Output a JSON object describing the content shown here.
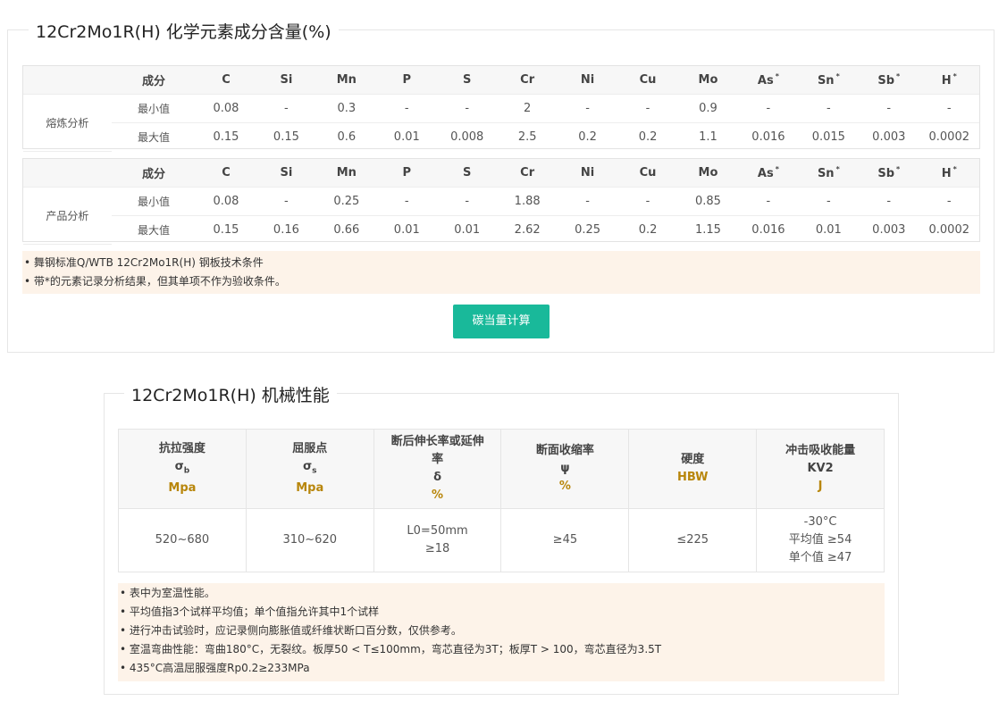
{
  "composition": {
    "title": "12Cr2Mo1R(H) 化学元素成分含量(%)",
    "header_label": "成分",
    "elements": [
      {
        "sym": "C",
        "star": false
      },
      {
        "sym": "Si",
        "star": false
      },
      {
        "sym": "Mn",
        "star": false
      },
      {
        "sym": "P",
        "star": false
      },
      {
        "sym": "S",
        "star": false
      },
      {
        "sym": "Cr",
        "star": false
      },
      {
        "sym": "Ni",
        "star": false
      },
      {
        "sym": "Cu",
        "star": false
      },
      {
        "sym": "Mo",
        "star": false
      },
      {
        "sym": "As",
        "star": true
      },
      {
        "sym": "Sn",
        "star": true
      },
      {
        "sym": "Sb",
        "star": true
      },
      {
        "sym": "H",
        "star": true
      }
    ],
    "star": "*",
    "tables": [
      {
        "label": "熔炼分析",
        "rows": [
          {
            "label": "最小值",
            "values": [
              "0.08",
              "-",
              "0.3",
              "-",
              "-",
              "2",
              "-",
              "-",
              "0.9",
              "-",
              "-",
              "-",
              "-"
            ]
          },
          {
            "label": "最大值",
            "values": [
              "0.15",
              "0.15",
              "0.6",
              "0.01",
              "0.008",
              "2.5",
              "0.2",
              "0.2",
              "1.1",
              "0.016",
              "0.015",
              "0.003",
              "0.0002"
            ]
          }
        ]
      },
      {
        "label": "产品分析",
        "rows": [
          {
            "label": "最小值",
            "values": [
              "0.08",
              "-",
              "0.25",
              "-",
              "-",
              "1.88",
              "-",
              "-",
              "0.85",
              "-",
              "-",
              "-",
              "-"
            ]
          },
          {
            "label": "最大值",
            "values": [
              "0.15",
              "0.16",
              "0.66",
              "0.01",
              "0.01",
              "2.62",
              "0.25",
              "0.2",
              "1.15",
              "0.016",
              "0.01",
              "0.003",
              "0.0002"
            ]
          }
        ]
      }
    ],
    "notes": [
      "• 舞钢标准Q/WTB 12Cr2Mo1R(H) 钢板技术条件",
      "• 带*的元素记录分析结果，但其单项不作为验收条件。"
    ],
    "button_label": "碳当量计算"
  },
  "mechanical": {
    "title": "12Cr2Mo1R(H) 机械性能",
    "columns": [
      {
        "name_lines": [
          "抗拉强度"
        ],
        "symbol": "σ",
        "symbol_sub": "b",
        "unit": "Mpa",
        "value_lines": [
          "520~680"
        ]
      },
      {
        "name_lines": [
          "屈服点"
        ],
        "symbol": "σ",
        "symbol_sub": "s",
        "unit": "Mpa",
        "value_lines": [
          "310~620"
        ]
      },
      {
        "name_lines": [
          "断后伸长率或延伸",
          "率"
        ],
        "symbol": "δ",
        "symbol_sub": "",
        "unit": "%",
        "value_lines": [
          "L0=50mm",
          "≥18"
        ]
      },
      {
        "name_lines": [
          "断面收缩率"
        ],
        "symbol": "ψ",
        "symbol_sub": "",
        "unit": "%",
        "value_lines": [
          "≥45"
        ]
      },
      {
        "name_lines": [
          "硬度"
        ],
        "symbol": "",
        "symbol_sub": "",
        "unit": "HBW",
        "value_lines": [
          "≤225"
        ]
      },
      {
        "name_lines": [
          "冲击吸收能量"
        ],
        "symbol": "KV2",
        "symbol_sub": "",
        "unit": "J",
        "value_lines": [
          "-30°C",
          "平均值 ≥54",
          "单个值 ≥47"
        ]
      }
    ],
    "notes": [
      "• 表中为室温性能。",
      "• 平均值指3个试样平均值；单个值指允许其中1个试样",
      "• 进行冲击试验时，应记录侧向膨胀值或纤维状断口百分数，仅供参考。",
      "• 室温弯曲性能：弯曲180°C，无裂纹。板厚50 < T≤100mm，弯芯直径为3T；板厚T > 100，弯芯直径为3.5T",
      "• 435°C高温屈服强度Rp0.2≥233MPa"
    ]
  }
}
